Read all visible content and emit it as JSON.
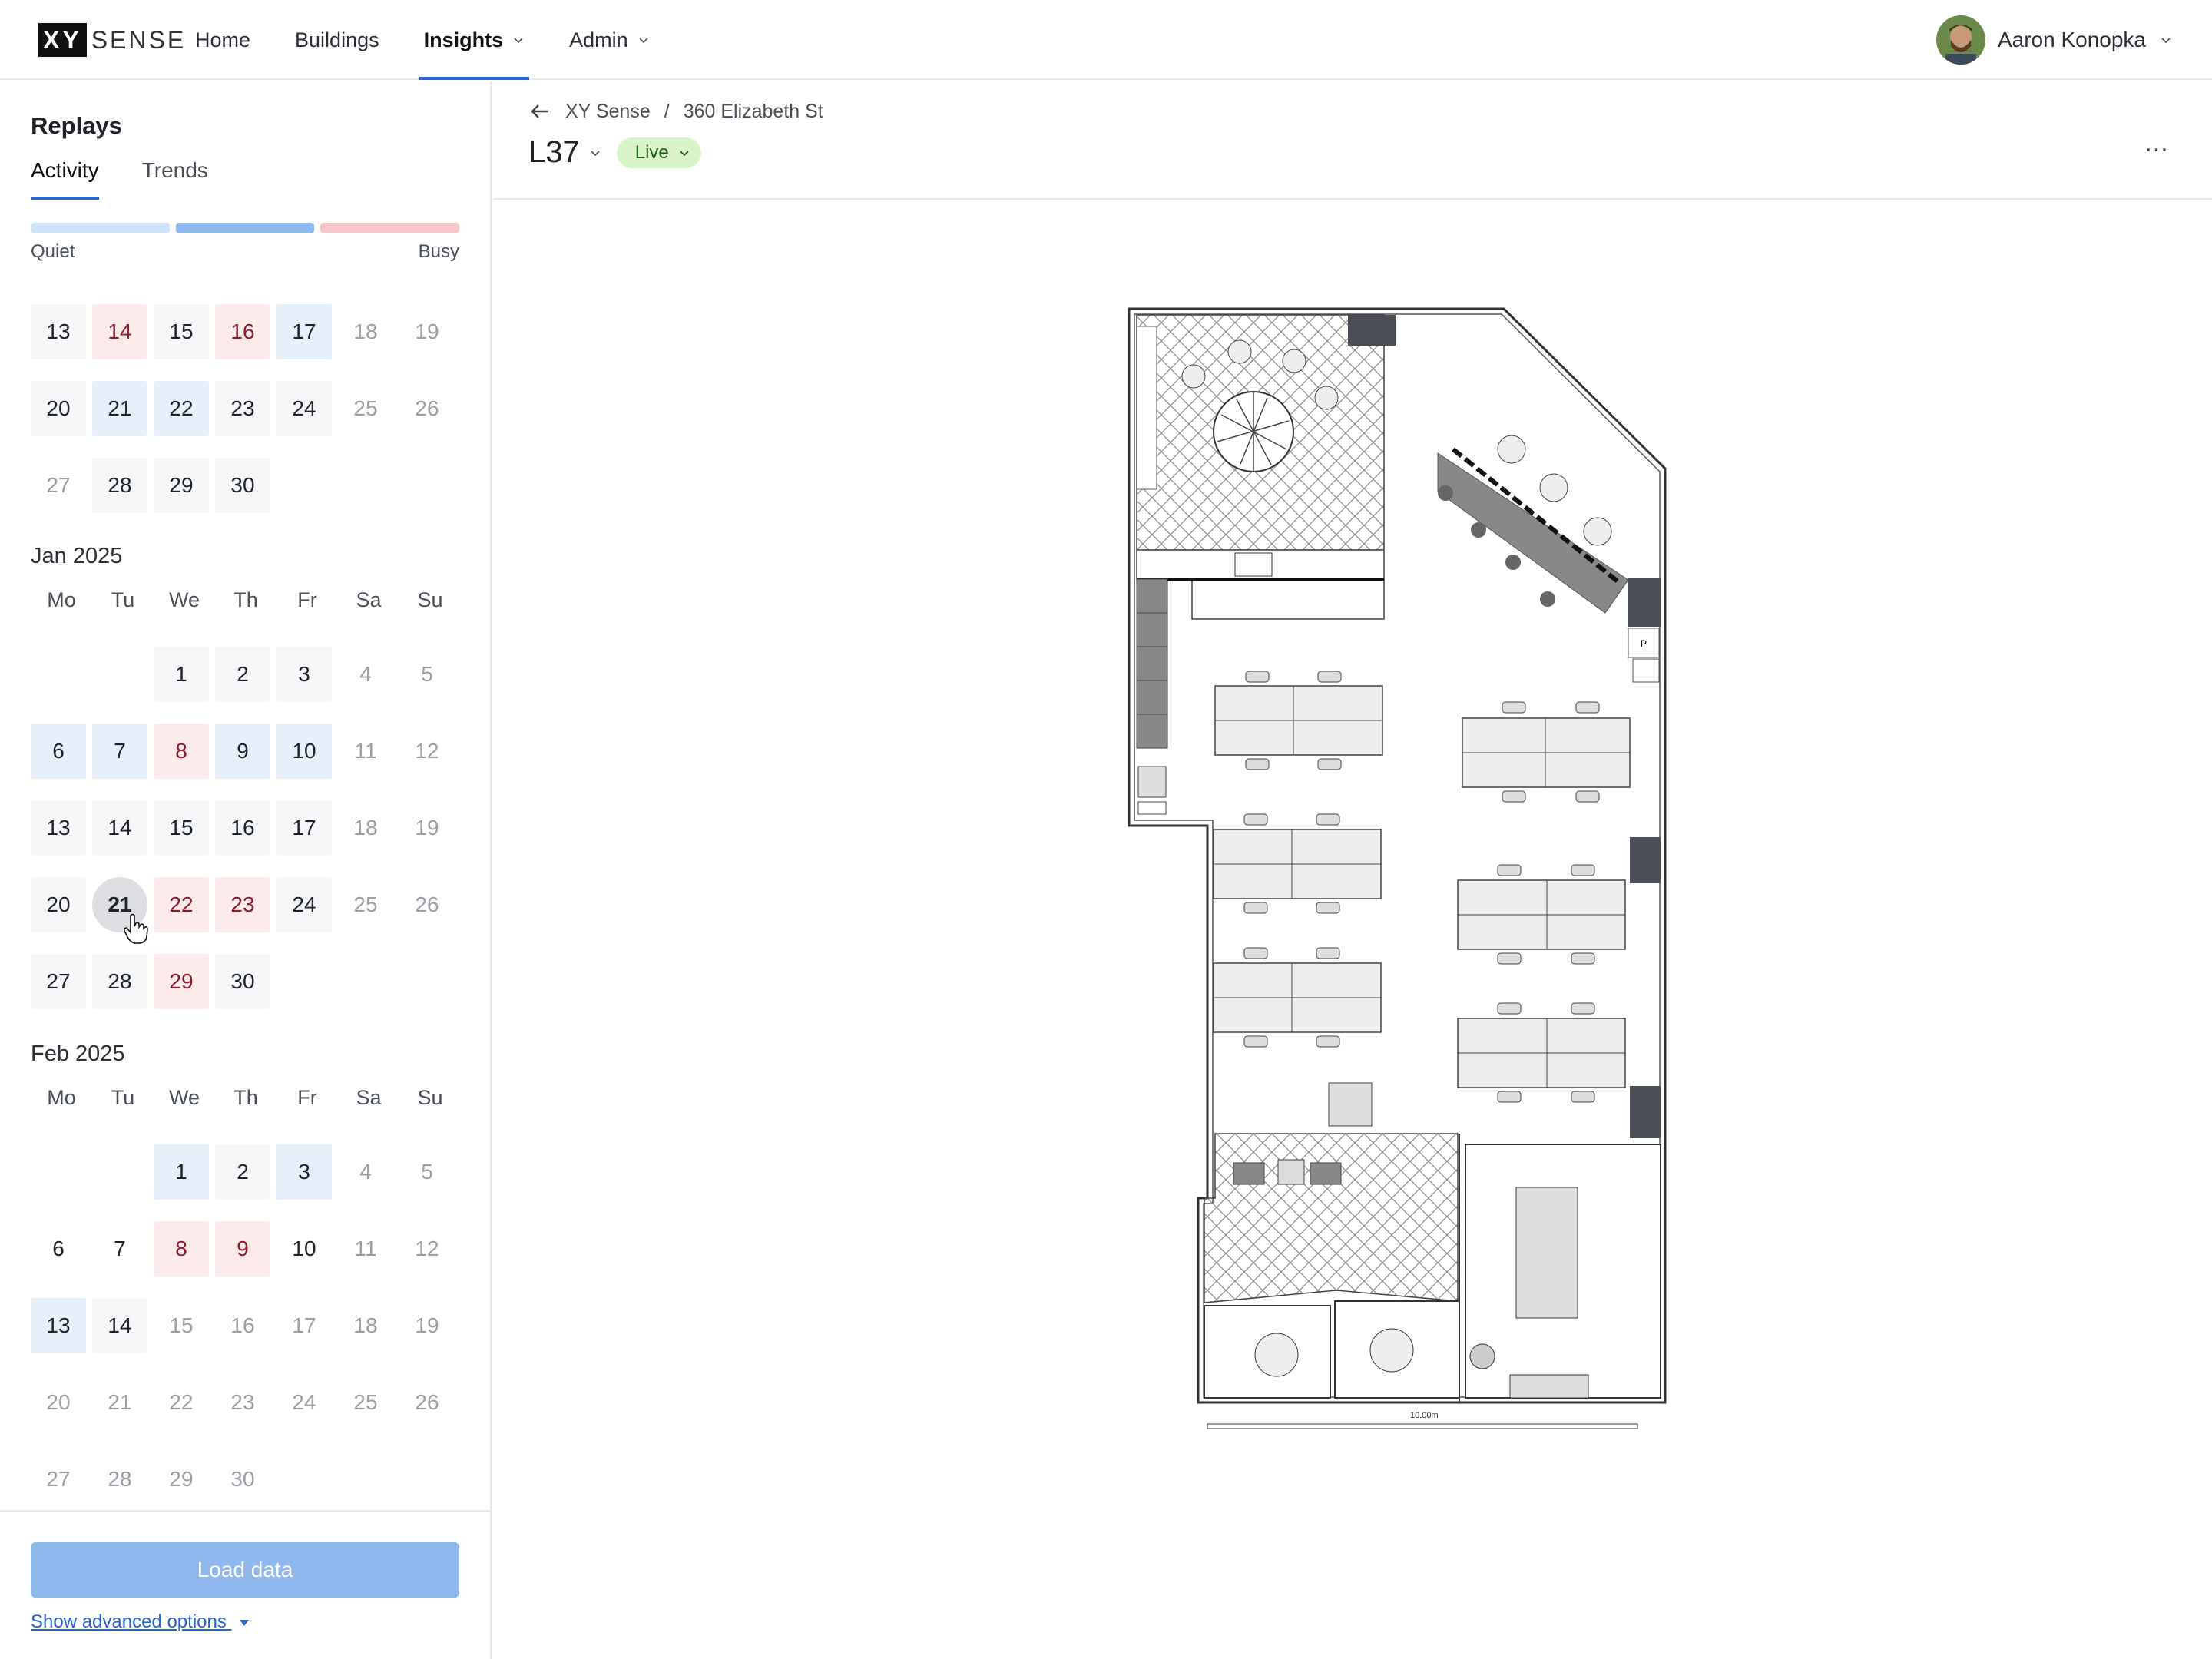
{
  "app": {
    "logo_mark": "XY",
    "logo_word": "SENSE",
    "nav": [
      "Home",
      "Buildings",
      "Insights",
      "Admin"
    ],
    "user_name": "Aaron Konopka"
  },
  "sidebar": {
    "title": "Replays",
    "tabs": [
      "Activity",
      "Trends"
    ],
    "legend": {
      "quiet": "Quiet",
      "busy": "Busy",
      "colors": [
        "#cfe2f8",
        "#8db9ee",
        "#f6c6ca"
      ]
    },
    "weekday_headers": [
      "Mo",
      "Tu",
      "We",
      "Th",
      "Fr",
      "Sa",
      "Su"
    ],
    "dec_weeks": [
      [
        "13",
        "14",
        "15",
        "16",
        "17",
        "18",
        "19"
      ],
      [
        "20",
        "21",
        "22",
        "23",
        "24",
        "25",
        "26"
      ],
      [
        "27",
        "28",
        "29",
        "30"
      ]
    ],
    "jan": {
      "label": "Jan 2025",
      "weeks": [
        [
          "",
          "",
          "1",
          "2",
          "3",
          "4",
          "5"
        ],
        [
          "6",
          "7",
          "8",
          "9",
          "10",
          "11",
          "12"
        ],
        [
          "13",
          "14",
          "15",
          "16",
          "17",
          "18",
          "19"
        ],
        [
          "20",
          "21",
          "22",
          "23",
          "24",
          "25",
          "26"
        ],
        [
          "27",
          "28",
          "29",
          "30"
        ]
      ]
    },
    "feb": {
      "label": "Feb 2025",
      "weeks": [
        [
          "",
          "",
          "1",
          "2",
          "3",
          "4",
          "5"
        ],
        [
          "6",
          "7",
          "8",
          "9",
          "10",
          "11",
          "12"
        ],
        [
          "13",
          "14",
          "15",
          "16",
          "17",
          "18",
          "19"
        ],
        [
          "20",
          "21",
          "22",
          "23",
          "24",
          "25",
          "26"
        ],
        [
          "27",
          "28",
          "29",
          "30"
        ]
      ]
    },
    "selected_day": "Jan 21",
    "load_button": "Load data",
    "advanced_link": "Show advanced options"
  },
  "main": {
    "breadcrumb": [
      "XY Sense",
      "360 Elizabeth St"
    ],
    "floor_name": "L37",
    "status_pill": "Live",
    "more_button": "...",
    "scale_label": "10.00m",
    "room_marker": "P"
  }
}
